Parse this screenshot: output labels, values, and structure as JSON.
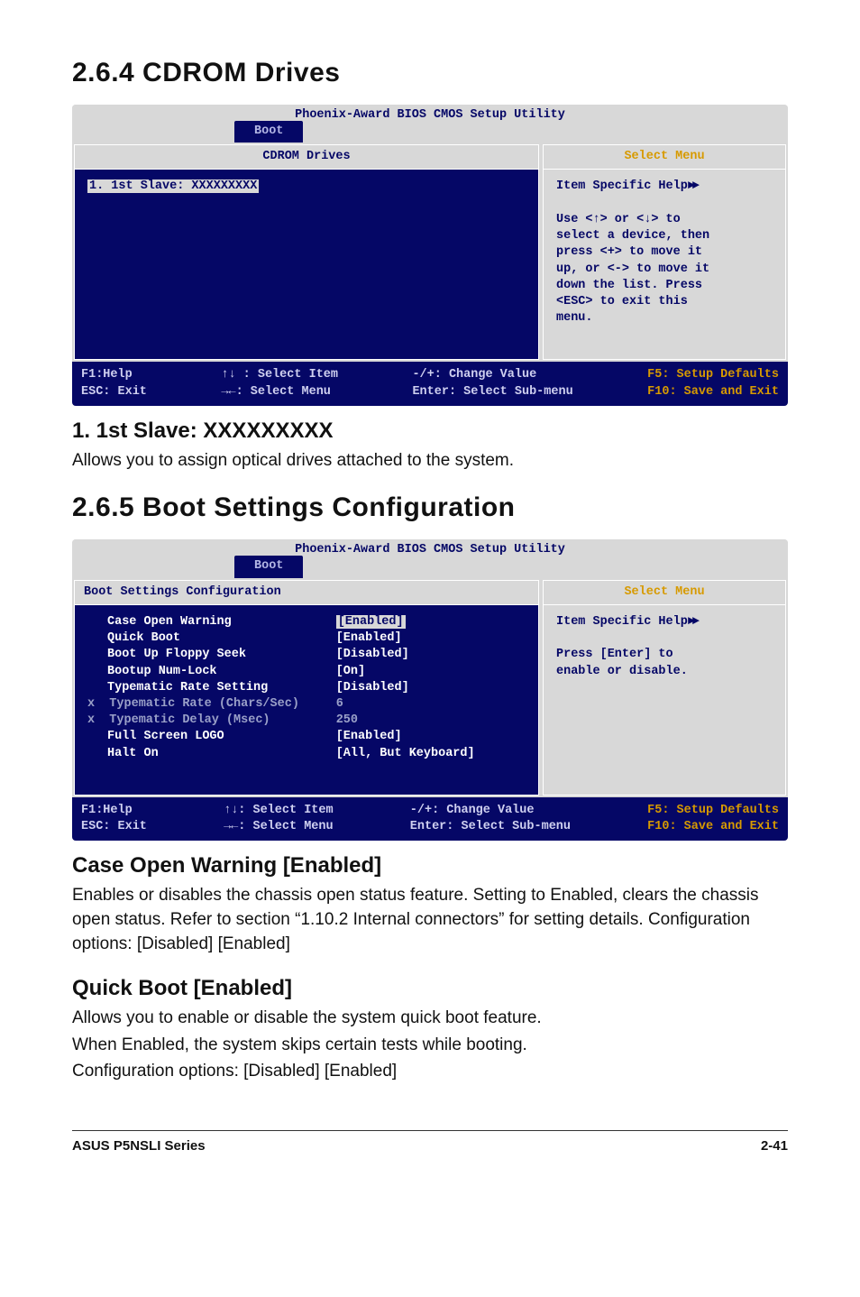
{
  "section264_title": "2.6.4  CDROM Drives",
  "bios1": {
    "title": "Phoenix-Award BIOS CMOS Setup Utility",
    "tab": "Boot",
    "left_head": "CDROM Drives",
    "right_head": "Select Menu",
    "item_line": "1. 1st Slave: XXXXXXXXX",
    "help_title": "Item Specific Help",
    "help_body_l1": "Use <↑> or <↓> to",
    "help_body_l2": "select a device, then",
    "help_body_l3": "press <+> to move it",
    "help_body_l4": "up, or <-> to move it",
    "help_body_l5": "down the list. Press",
    "help_body_l6": "<ESC> to exit this",
    "help_body_l7": "menu.",
    "foot_l1": "F1:Help",
    "foot_l2": "ESC: Exit",
    "foot_m1a": "↑↓ : Select Item",
    "foot_m1b": "→←: Select Menu",
    "foot_m2a": "-/+: Change Value",
    "foot_m2b": "Enter: Select Sub-menu",
    "foot_r1": "F5: Setup Defaults",
    "foot_r2": "F10: Save and Exit"
  },
  "sub1_title": "1. 1st Slave: XXXXXXXXX",
  "sub1_body": "Allows you to assign optical drives attached to the system.",
  "section265_title": "2.6.5  Boot Settings Configuration",
  "bios2": {
    "title": "Phoenix-Award BIOS CMOS Setup Utility",
    "tab": "Boot",
    "left_head": "Boot Settings Configuration",
    "right_head": "Select Menu",
    "labels": {
      "l1": "Case Open Warning",
      "l2": "Quick Boot",
      "l3": "Boot Up Floppy Seek",
      "l4": "Bootup Num-Lock",
      "l5": "Typematic Rate Setting",
      "l6": "x  Typematic Rate (Chars/Sec)",
      "l7": "x  Typematic Delay (Msec)",
      "l8": "Full Screen LOGO",
      "l9": "Halt On"
    },
    "vals": {
      "v1": "[Enabled]",
      "v2": "[Enabled]",
      "v3": "[Disabled]",
      "v4": "[On]",
      "v5": "[Disabled]",
      "v6": "6",
      "v7": "250",
      "v8": "[Enabled]",
      "v9": "[All, But Keyboard]"
    },
    "help_title": "Item Specific Help",
    "help_body_l1": "Press [Enter] to",
    "help_body_l2": "enable or disable.",
    "foot_l1": "F1:Help",
    "foot_l2": "ESC: Exit",
    "foot_m1a": "↑↓: Select Item",
    "foot_m1b": "→←: Select Menu",
    "foot_m2a": "-/+: Change Value",
    "foot_m2b": "Enter: Select Sub-menu",
    "foot_r1": "F5: Setup Defaults",
    "foot_r2": "F10: Save and Exit"
  },
  "sub2_title": "Case Open Warning [Enabled]",
  "sub2_body": "Enables or disables the chassis open status feature. Setting to Enabled, clears the chassis open status. Refer to section “1.10.2 Internal connectors” for setting details. Configuration options: [Disabled] [Enabled]",
  "sub3_title": "Quick Boot [Enabled]",
  "sub3_body_l1": "Allows you to enable or disable the system quick boot feature.",
  "sub3_body_l2": "When Enabled, the system skips certain tests while booting.",
  "sub3_body_l3": "Configuration options: [Disabled] [Enabled]",
  "footer_left": "ASUS P5NSLI Series",
  "footer_right": "2-41"
}
